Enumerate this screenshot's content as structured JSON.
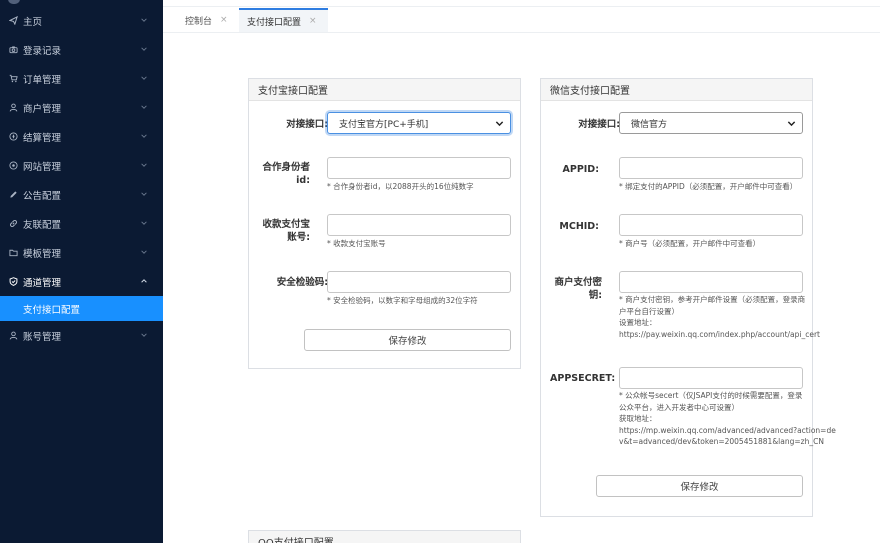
{
  "sidebar": {
    "items": [
      {
        "label": "主页",
        "icon": "paper-plane-icon"
      },
      {
        "label": "登录记录",
        "icon": "camera-icon"
      },
      {
        "label": "订单管理",
        "icon": "cart-icon"
      },
      {
        "label": "商户管理",
        "icon": "user-icon"
      },
      {
        "label": "结算管理",
        "icon": "compass-icon"
      },
      {
        "label": "网站管理",
        "icon": "target-icon"
      },
      {
        "label": "公告配置",
        "icon": "pencil-icon"
      },
      {
        "label": "友联配置",
        "icon": "link-icon"
      },
      {
        "label": "模板管理",
        "icon": "folder-icon"
      },
      {
        "label": "通道管理",
        "icon": "shield-icon"
      }
    ],
    "subitem": {
      "label": "支付接口配置"
    },
    "last_item": {
      "label": "账号管理",
      "icon": "user-icon"
    }
  },
  "tabs": [
    {
      "label": "控制台",
      "close": "×"
    },
    {
      "label": "支付接口配置",
      "close": "×"
    }
  ],
  "alipay": {
    "title": "支付宝接口配置",
    "interface_label": "对接接口:",
    "interface_value": "支付宝官方[PC+手机]",
    "pid_label": "合作身份者id:",
    "pid_hint": "* 合作身份者id，以2088开头的16位纯数字",
    "account_label": "收款支付宝账号:",
    "account_hint": "* 收款支付宝账号",
    "key_label": "安全检验码:",
    "key_hint": "* 安全检验码，以数字和字母组成的32位字符",
    "save": "保存修改"
  },
  "wechat": {
    "title": "微信支付接口配置",
    "interface_label": "对接接口:",
    "interface_value": "微信官方",
    "appid_label": "APPID:",
    "appid_hint": "* 绑定支付的APPID（必须配置，开户邮件中可查看）",
    "mchid_label": "MCHID:",
    "mchid_hint": "* 商户号（必须配置，开户邮件中可查看）",
    "key_label": "商户支付密钥:",
    "key_hint": "* 商户支付密钥，参考开户邮件设置（必须配置，登录商户平台自行设置）",
    "key_addr_label": "设置地址：",
    "key_addr": "https://pay.weixin.qq.com/index.php/account/api_cert",
    "secret_label": "APPSECRET:",
    "secret_hint": "* 公众帐号secert（仅JSAPI支付的时候需要配置，登录公众平台，进入开发者中心可设置）",
    "secret_addr_label": "获取地址：",
    "secret_addr": "https://mp.weixin.qq.com/advanced/advanced?action=dev&t=advanced/dev&token=2005451881&lang=zh_CN",
    "save": "保存修改"
  },
  "qq": {
    "title": "QQ支付接口配置"
  }
}
